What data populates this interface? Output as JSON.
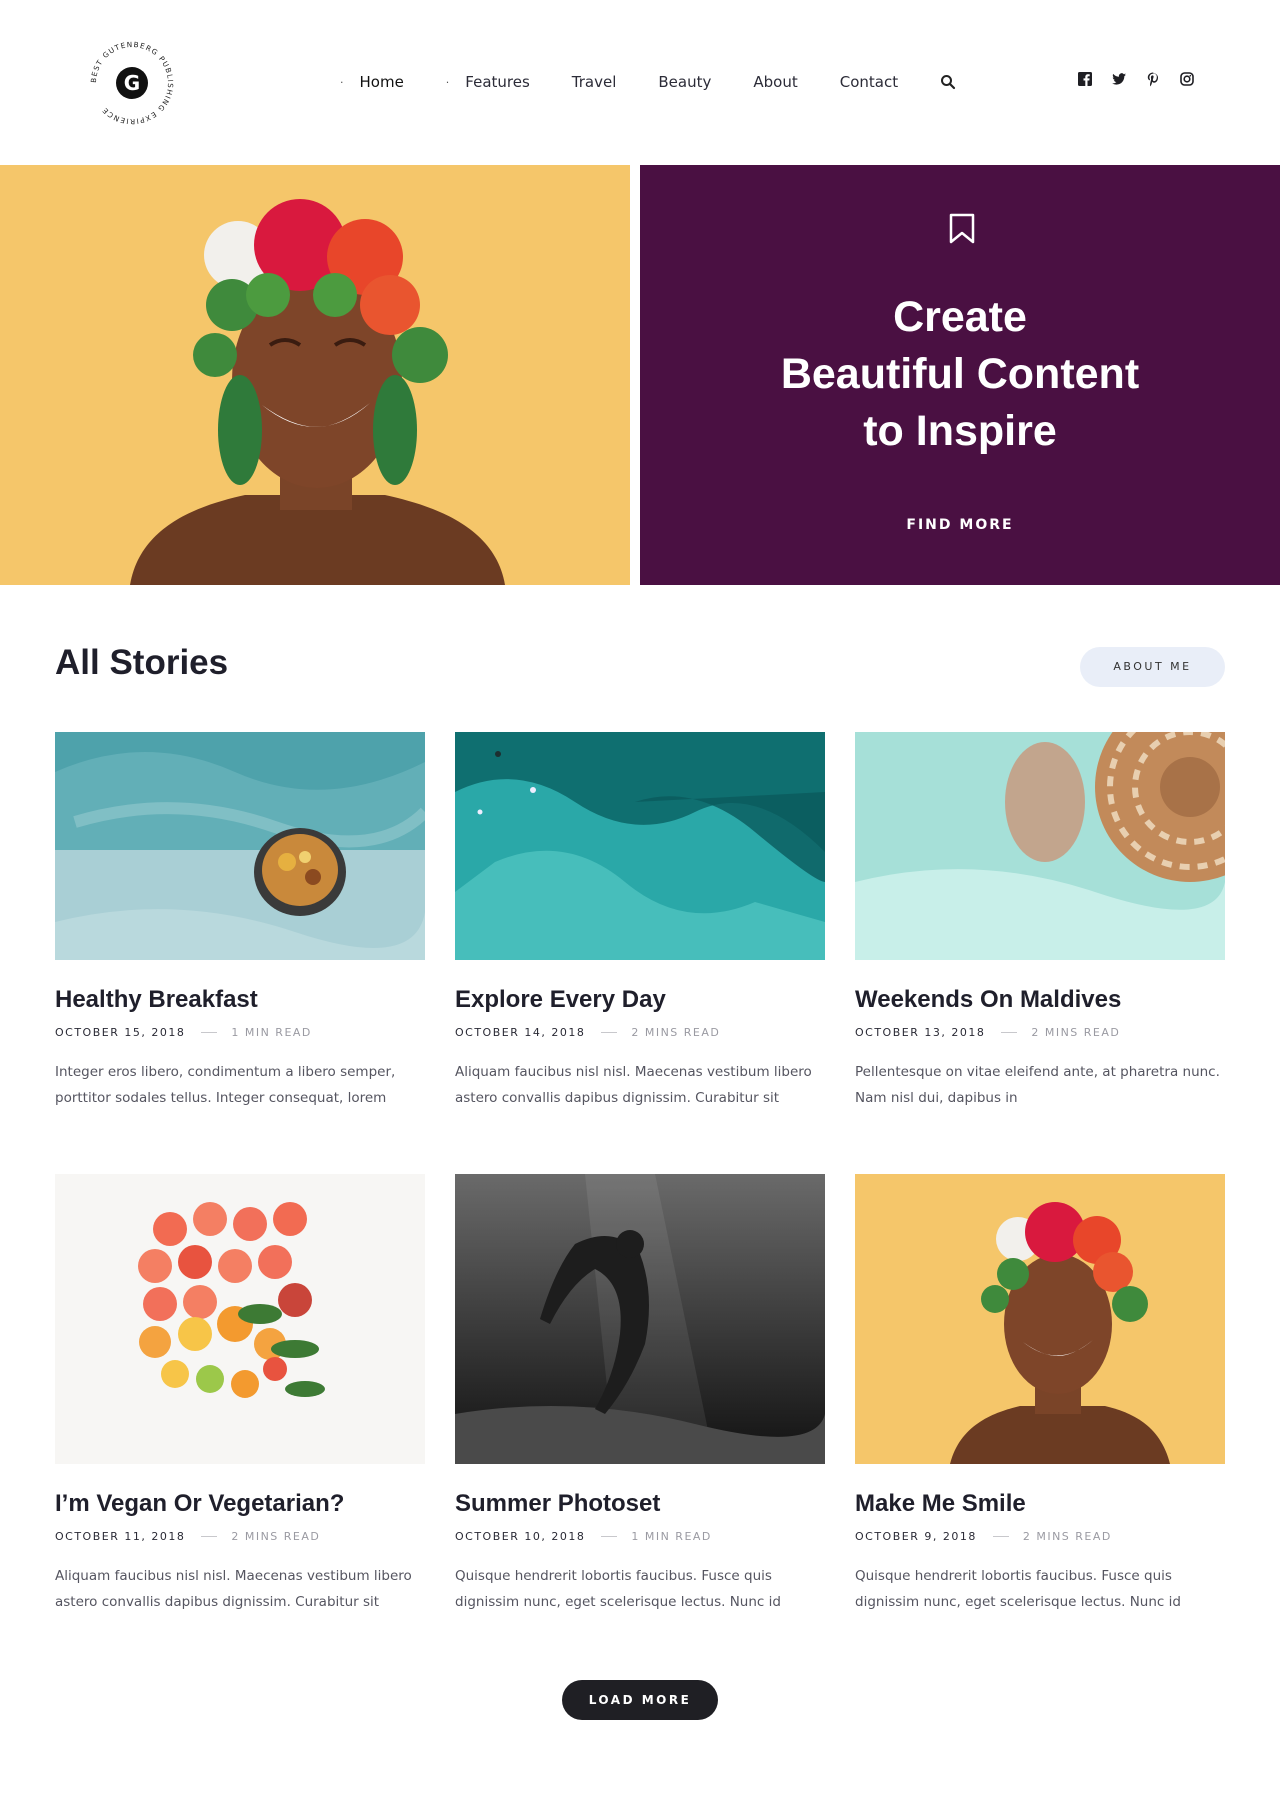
{
  "logo": {
    "letter": "G",
    "ring_text": "BEST GUTENBERG PUBLISHING EXPIRIENCE"
  },
  "nav": {
    "items": [
      {
        "label": "Home",
        "icon": "dot"
      },
      {
        "label": "Features",
        "icon": "dot"
      },
      {
        "label": "Travel"
      },
      {
        "label": "Beauty"
      },
      {
        "label": "About"
      },
      {
        "label": "Contact"
      }
    ],
    "search_icon": "search-icon"
  },
  "social": [
    "facebook-icon",
    "twitter-icon",
    "pinterest-icon",
    "instagram-icon"
  ],
  "hero": {
    "title_lines": [
      "Create",
      "Beautiful Content",
      "to Inspire"
    ],
    "cta": "FIND MORE",
    "panel_color": "#4a1042",
    "image_bg": "#f5c66a"
  },
  "section": {
    "title": "All Stories",
    "about_button": "ABOUT ME"
  },
  "stories": [
    {
      "title": "Healthy Breakfast",
      "date": "OCTOBER 15, 2018",
      "read": "1 MIN READ",
      "excerpt": "Integer eros libero, condimentum a libero semper, porttitor sodales tellus. Integer consequat, lorem"
    },
    {
      "title": "Explore Every Day",
      "date": "OCTOBER 14, 2018",
      "read": "2 MINS READ",
      "excerpt": "Aliquam faucibus nisl nisl. Maecenas vestibum libero astero convallis dapibus dignissim. Curabitur sit"
    },
    {
      "title": "Weekends On Maldives",
      "date": "OCTOBER 13, 2018",
      "read": "2 MINS READ",
      "excerpt": "Pellentesque on vitae eleifend ante, at pharetra nunc. Nam nisl dui, dapibus in"
    },
    {
      "title": "I’m Vegan Or Vegetarian?",
      "date": "OCTOBER 11, 2018",
      "read": "2 MINS READ",
      "excerpt": "Aliquam faucibus nisl nisl. Maecenas vestibum libero astero convallis dapibus dignissim. Curabitur sit"
    },
    {
      "title": "Summer Photoset",
      "date": "OCTOBER 10, 2018",
      "read": "1 MIN READ",
      "excerpt": "Quisque hendrerit lobortis faucibus. Fusce quis dignissim nunc, eget scelerisque lectus. Nunc id"
    },
    {
      "title": "Make Me Smile",
      "date": "OCTOBER 9, 2018",
      "read": "2 MINS READ",
      "excerpt": "Quisque hendrerit lobortis faucibus. Fusce quis dignissim nunc, eget scelerisque lectus. Nunc id"
    }
  ],
  "load_more": "LOAD MORE"
}
